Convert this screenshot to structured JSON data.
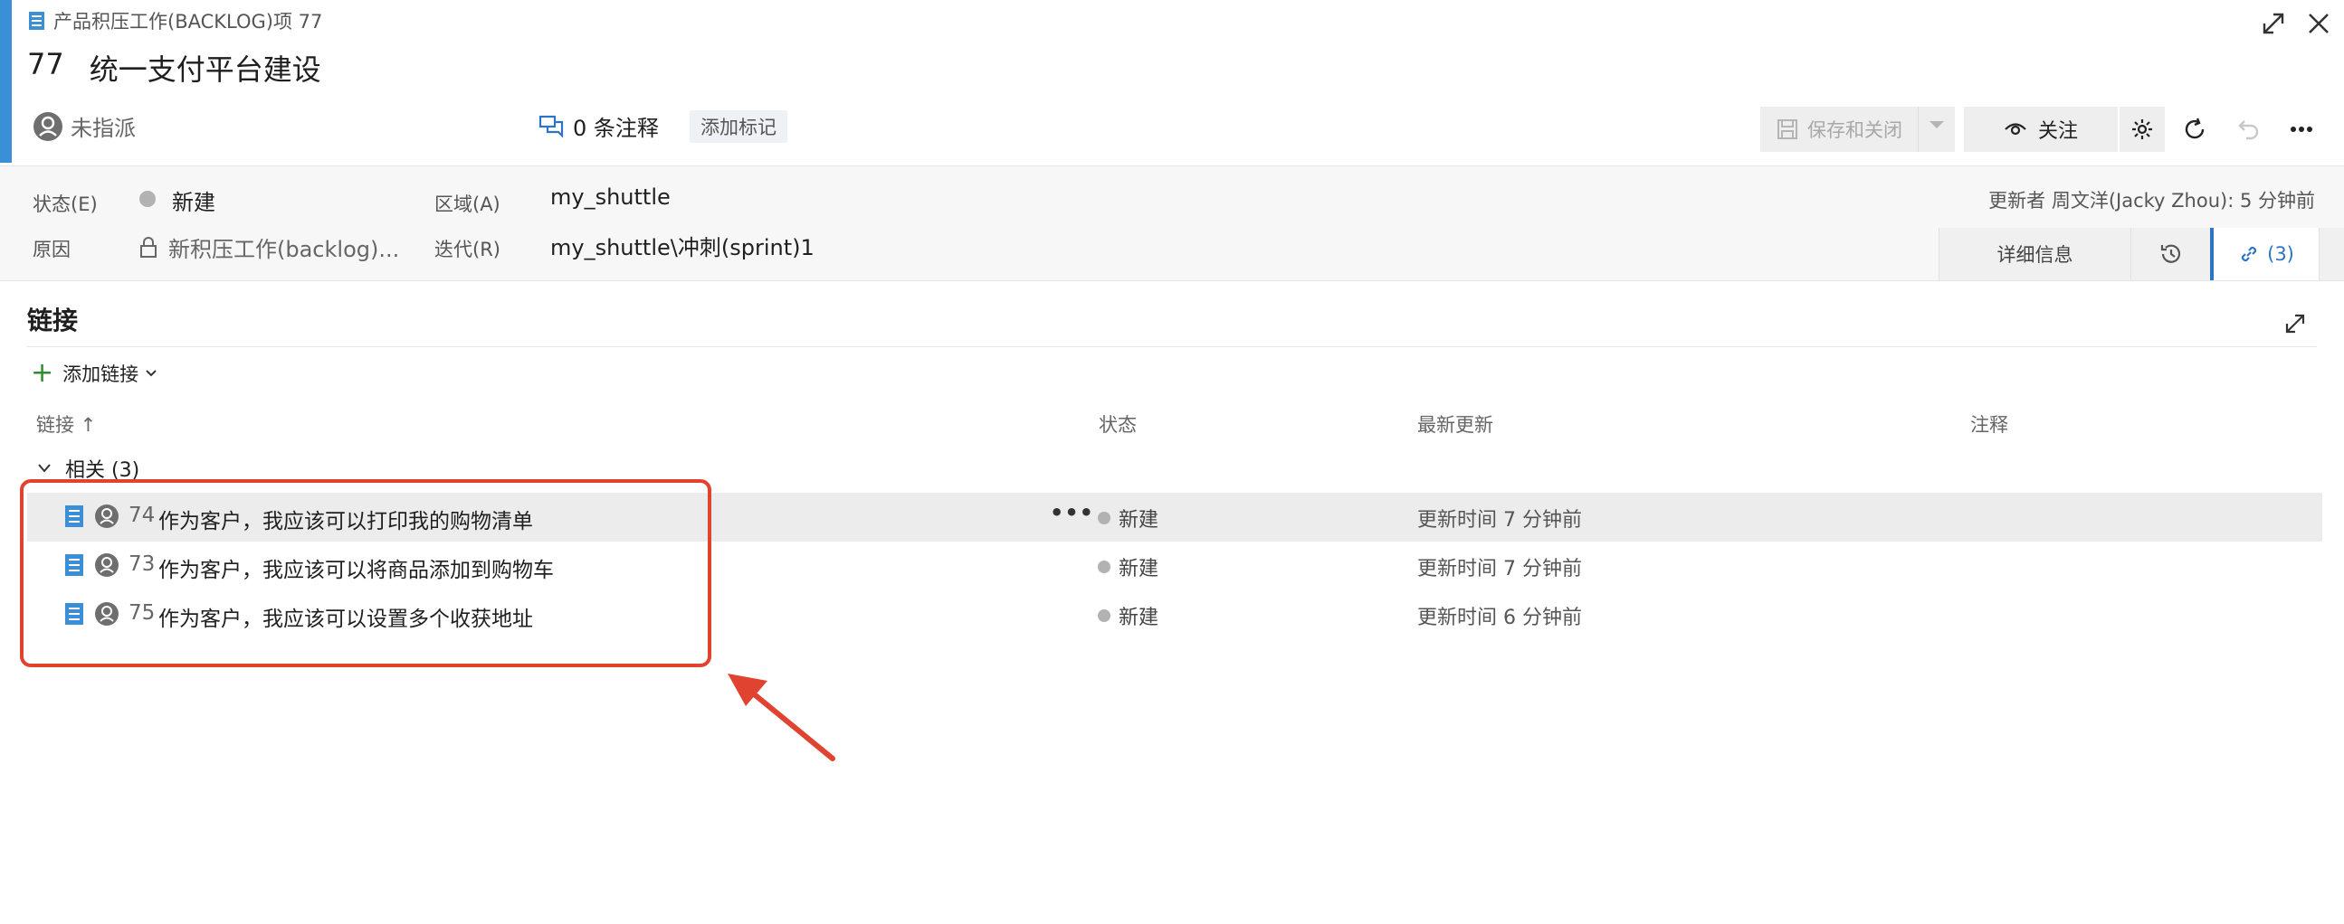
{
  "header": {
    "breadcrumb": "产品积压工作(BACKLOG)项 77",
    "item_id": "77",
    "item_title": "统一支付平台建设",
    "assignee": "未指派",
    "comments": "0 条注释",
    "add_tag": "添加标记",
    "save_close": "保存和关闭",
    "follow": "关注"
  },
  "fields": {
    "state_label": "状态(E)",
    "state_value": "新建",
    "reason_label": "原因",
    "reason_value": "新积压工作(backlog)...",
    "area_label": "区域(A)",
    "area_value": "my_shuttle",
    "iteration_label": "迭代(R)",
    "iteration_value": "my_shuttle\\冲刺(sprint)1",
    "updated_by": "更新者 周文洋(Jacky Zhou): 5 分钟前"
  },
  "tabs": {
    "details": "详细信息",
    "links": "(3)"
  },
  "links": {
    "section_title": "链接",
    "add_link": "添加链接",
    "columns": {
      "link": "链接 ↑",
      "state": "状态",
      "updated": "最新更新",
      "comment": "注释"
    },
    "group_label": "相关 (3)",
    "rows": [
      {
        "id": "74",
        "title": "作为客户，我应该可以打印我的购物清单",
        "state": "新建",
        "updated": "更新时间 7 分钟前",
        "more": "•••"
      },
      {
        "id": "73",
        "title": "作为客户，我应该可以将商品添加到购物车",
        "state": "新建",
        "updated": "更新时间 7 分钟前"
      },
      {
        "id": "75",
        "title": "作为客户，我应该可以设置多个收获地址",
        "state": "新建",
        "updated": "更新时间 6 分钟前"
      }
    ]
  },
  "colors": {
    "accent": "#3a8fd6",
    "link_tab": "#2d74c4",
    "annotation": "#e0432f",
    "state_dot": "#b2b2b2"
  }
}
